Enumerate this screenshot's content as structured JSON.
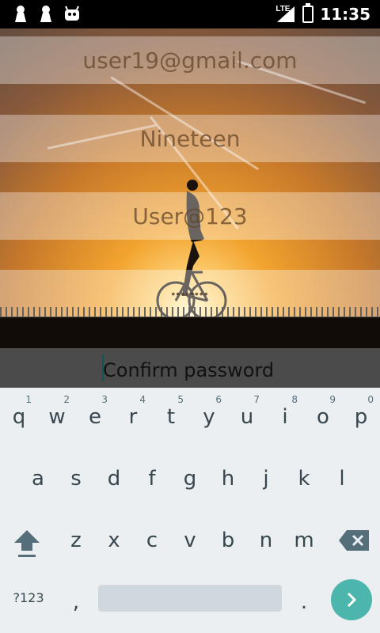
{
  "status_bar": {
    "time": "11:35",
    "network": "LTE",
    "left_icons": [
      "keyhole-icon",
      "keyhole-icon",
      "android-icon"
    ]
  },
  "form": {
    "email_value": "user19@gmail.com",
    "name_value": "Nineteen",
    "password_value": "User@123",
    "hidden_password": "••••••••",
    "confirm_placeholder": "Confirm password"
  },
  "keyboard": {
    "row1": [
      {
        "key": "q",
        "num": "1"
      },
      {
        "key": "w",
        "num": "2"
      },
      {
        "key": "e",
        "num": "3"
      },
      {
        "key": "r",
        "num": "4"
      },
      {
        "key": "t",
        "num": "5"
      },
      {
        "key": "y",
        "num": "6"
      },
      {
        "key": "u",
        "num": "7"
      },
      {
        "key": "i",
        "num": "8"
      },
      {
        "key": "o",
        "num": "9"
      },
      {
        "key": "p",
        "num": "0"
      }
    ],
    "row2": [
      "a",
      "s",
      "d",
      "f",
      "g",
      "h",
      "j",
      "k",
      "l"
    ],
    "row3": [
      "z",
      "x",
      "c",
      "v",
      "b",
      "n",
      "m"
    ],
    "symbols_label": "?123",
    "comma": ",",
    "period": "."
  },
  "colors": {
    "keyboard_bg": "#eceff1",
    "enter_key": "#4db6ac",
    "confirm_band": "#4b4b4b"
  }
}
